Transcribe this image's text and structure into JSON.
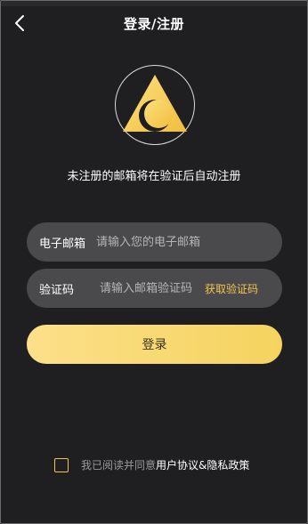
{
  "header": {
    "title": "登录/注册",
    "back_icon": "chevron-left-icon"
  },
  "logo": {
    "icon": "triangle-moon-logo-icon",
    "accent": "#f7cd55"
  },
  "notice": "未注册的邮箱将在验证后自动注册",
  "email_field": {
    "label": "电子邮箱",
    "placeholder": "请输入您的电子邮箱",
    "value": ""
  },
  "code_field": {
    "label": "验证码",
    "placeholder": "请输入邮箱验证码",
    "value": "",
    "get_code": "获取验证码"
  },
  "login_button": "登录",
  "agreement": {
    "prefix": "我已阅读并同意",
    "terms": "用户协议",
    "amp": "&",
    "privacy": "隐私政策",
    "checked": false
  },
  "colors": {
    "background": "#1f1f21",
    "accent": "#f2c44f",
    "field": "#4a4a4c"
  }
}
